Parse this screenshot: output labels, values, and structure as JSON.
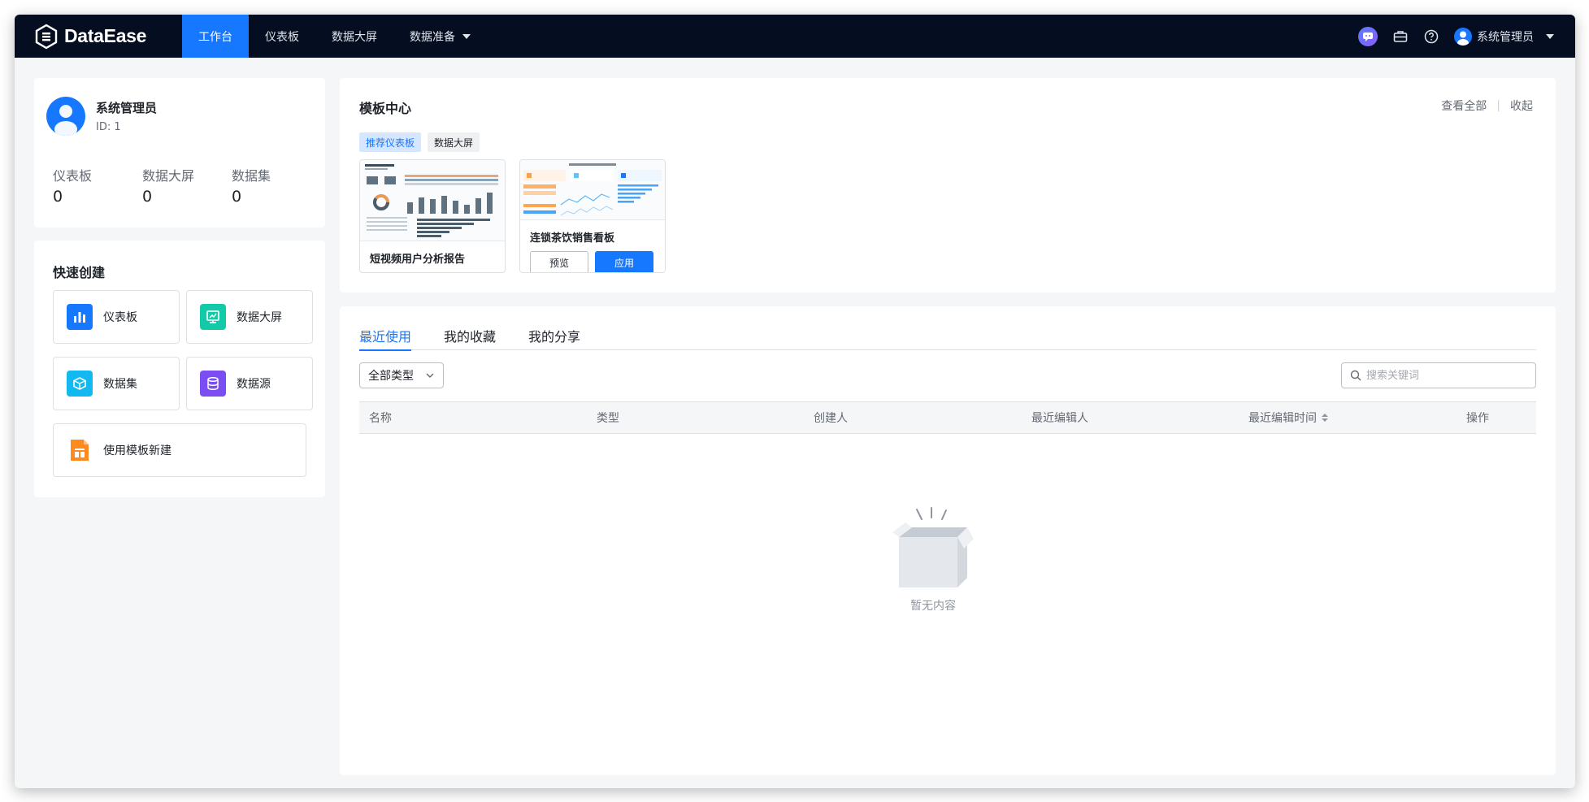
{
  "app": {
    "name": "DataEase"
  },
  "nav": {
    "items": [
      {
        "label": "工作台",
        "active": true
      },
      {
        "label": "仪表板"
      },
      {
        "label": "数据大屏"
      },
      {
        "label": "数据准备",
        "dropdown": true
      }
    ]
  },
  "header": {
    "icons": [
      "ai-assistant-icon",
      "toolbox-icon",
      "help-icon"
    ],
    "user": "系统管理员"
  },
  "profile": {
    "name": "系统管理员",
    "id": "ID:  1",
    "stats": [
      {
        "label": "仪表板",
        "value": "0"
      },
      {
        "label": "数据大屏",
        "value": "0"
      },
      {
        "label": "数据集",
        "value": "0"
      }
    ]
  },
  "quick_create": {
    "title": "快速创建",
    "items": [
      {
        "label": "仪表板",
        "icon": "bar-chart-icon",
        "color": "#1677ff"
      },
      {
        "label": "数据大屏",
        "icon": "screen-icon",
        "color": "#14c9a7"
      },
      {
        "label": "数据集",
        "icon": "cube-icon",
        "color": "#12b8f0"
      },
      {
        "label": "数据源",
        "icon": "database-icon",
        "color": "#7b4ef4"
      },
      {
        "label": "使用模板新建",
        "icon": "template-icon",
        "color": "#ff8a1f"
      }
    ]
  },
  "template_center": {
    "title": "模板中心",
    "view_all": "查看全部",
    "collapse": "收起",
    "tags": [
      {
        "label": "推荐仪表板",
        "active": true
      },
      {
        "label": "数据大屏"
      }
    ],
    "templates": [
      {
        "name": "短视频用户分析报告"
      },
      {
        "name": "连锁茶饮销售看板",
        "preview": "预览",
        "apply": "应用"
      }
    ]
  },
  "recent": {
    "tabs": [
      {
        "label": "最近使用",
        "active": true
      },
      {
        "label": "我的收藏"
      },
      {
        "label": "我的分享"
      }
    ],
    "type_filter": "全部类型",
    "search_placeholder": "搜索关键词",
    "columns": [
      "名称",
      "类型",
      "创建人",
      "最近编辑人",
      "最近编辑时间",
      "操作"
    ],
    "empty_text": "暂无内容"
  },
  "colors": {
    "accent": "#1677ff",
    "topbar": "#050e21"
  }
}
